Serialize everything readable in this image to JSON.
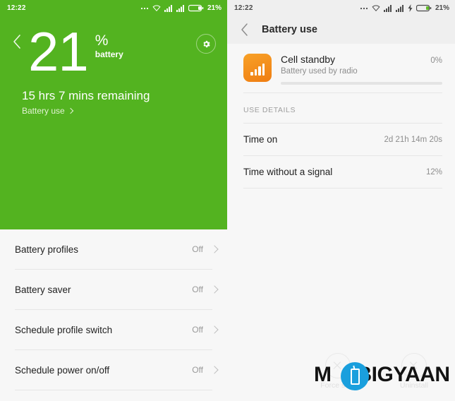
{
  "colors": {
    "hero_green": "#53b320",
    "status_green": "#53b320",
    "accent_orange": "#f39420",
    "app_background": "#f7f7f7",
    "appbar_grey": "#efefef",
    "watermark_blue": "#1a9fdd"
  },
  "left_screen": {
    "statusbar": {
      "time": "12:22",
      "battery_percent": "21%",
      "icons": [
        "more-dots-icon",
        "wifi-icon",
        "signal-sim1-icon",
        "signal-sim2-icon",
        "battery-icon"
      ]
    },
    "hero": {
      "back_icon": "chevron-left-icon",
      "settings_icon": "gear-icon",
      "percent_number": "21",
      "percent_sign": "%",
      "percent_word": "battery",
      "remaining_text": "15 hrs 7 mins remaining",
      "battery_use_link": "Battery use"
    },
    "settings_list": [
      {
        "label": "Battery profiles",
        "value": "Off"
      },
      {
        "label": "Battery saver",
        "value": "Off"
      },
      {
        "label": "Schedule profile switch",
        "value": "Off"
      },
      {
        "label": "Schedule power on/off",
        "value": "Off"
      }
    ]
  },
  "right_screen": {
    "statusbar": {
      "time": "12:22",
      "battery_percent": "21%",
      "icons": [
        "more-dots-icon",
        "wifi-icon",
        "signal-sim1-icon",
        "signal-sim2-icon",
        "charging-bolt-icon",
        "battery-icon"
      ]
    },
    "appbar": {
      "back_icon": "chevron-left-icon",
      "title": "Battery use"
    },
    "app_card": {
      "icon": "signal-bars-icon",
      "title": "Cell standby",
      "subtitle": "Battery used by radio",
      "percent": "0%",
      "progress_value": 0
    },
    "section_label": "USE DETAILS",
    "details": [
      {
        "label": "Time on",
        "value": "2d 21h 14m 20s"
      },
      {
        "label": "Time without a signal",
        "value": "12%"
      }
    ],
    "ghost_actions": [
      {
        "label": "Force stop",
        "icon": "close-circle-icon"
      },
      {
        "label": "Uninstall",
        "icon": "close-circle-icon"
      }
    ],
    "watermark": {
      "text_start": "M",
      "text_end": "BIGYAAN",
      "icon": "mobile-phone-icon"
    }
  }
}
